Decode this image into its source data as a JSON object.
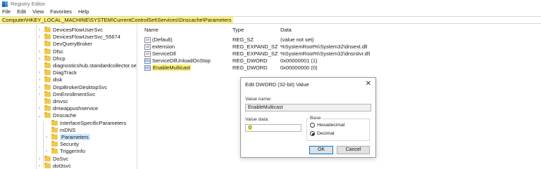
{
  "window": {
    "title": "Registry Editor"
  },
  "menu": [
    "File",
    "Edit",
    "View",
    "Favorites",
    "Help"
  ],
  "address": "Computer\\HKEY_LOCAL_MACHINE\\SYSTEM\\CurrentControlSet\\Services\\Dnscache\\Parameters",
  "tree": [
    {
      "label": "DevicesFlowUserSvc",
      "expander": "chevron-right"
    },
    {
      "label": "DevicesFlowUserSvc_55674",
      "expander": "chevron-right"
    },
    {
      "label": "DevQueryBroker",
      "expander": ""
    },
    {
      "label": "Dfsc",
      "expander": "chevron-right"
    },
    {
      "label": "Dhcp",
      "expander": "chevron-right"
    },
    {
      "label": "diagnosticshub.standardcollector.service",
      "expander": ""
    },
    {
      "label": "DiagTrack",
      "expander": "chevron-right"
    },
    {
      "label": "disk",
      "expander": "chevron-right"
    },
    {
      "label": "DispBrokerDesktopSvc",
      "expander": "chevron-right"
    },
    {
      "label": "DmEnrollmentSvc",
      "expander": "chevron-right"
    },
    {
      "label": "dmvsc",
      "expander": ""
    },
    {
      "label": "dmwappushservice",
      "expander": "chevron-right"
    },
    {
      "label": "Dnscache",
      "expander": "chevron-down"
    },
    {
      "label": "InterfaceSpecificParameters",
      "expander": ""
    },
    {
      "label": "mDNS",
      "expander": ""
    },
    {
      "label": "Parameters",
      "expander": "chevron-right",
      "selected": true
    },
    {
      "label": "Security",
      "expander": ""
    },
    {
      "label": "TriggerInfo",
      "expander": "chevron-right"
    },
    {
      "label": "DoSvc",
      "expander": "chevron-right"
    },
    {
      "label": "dot3svc",
      "expander": "chevron-right"
    }
  ],
  "columns": {
    "name": "Name",
    "type": "Type",
    "data": "Data"
  },
  "values": [
    {
      "icon": "ab",
      "name": "(Default)",
      "type": "REG_SZ",
      "data": "(value not set)"
    },
    {
      "icon": "ab",
      "name": "extension",
      "type": "REG_EXPAND_SZ",
      "data": "%SystemRoot%\\System32\\dnsext.dll"
    },
    {
      "icon": "ab",
      "name": "ServiceDll",
      "type": "REG_EXPAND_SZ",
      "data": "%SystemRoot%\\System32\\dnsrslvr.dll"
    },
    {
      "icon": "011",
      "name": "ServiceDllUnloadOnStop",
      "type": "REG_DWORD",
      "data": "0x00000001 (1)"
    },
    {
      "icon": "011",
      "name": "EnableMulticast",
      "type": "REG_DWORD",
      "data": "0x00000000 (0)",
      "selected": true
    }
  ],
  "dialog": {
    "title": "Edit DWORD (32-bit) Value",
    "close": "✕",
    "value_name_label": "Value name:",
    "value_name": "EnableMulticast",
    "value_data_label": "Value data:",
    "value_data": "0",
    "base_label": "Base",
    "hex_label": "Hexadecimal",
    "dec_label": "Decimal",
    "base_selected": "Decimal",
    "ok_label": "OK",
    "cancel_label": "Cancel"
  }
}
